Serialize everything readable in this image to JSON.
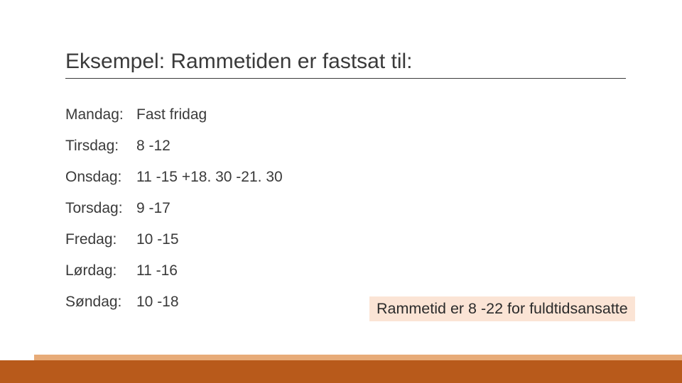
{
  "title": "Eksempel: Rammetiden er fastsat til:",
  "schedule": [
    {
      "day": "Mandag:",
      "value": "Fast fridag"
    },
    {
      "day": "Tirsdag:",
      "value": "8 -12"
    },
    {
      "day": "Onsdag:",
      "value": "11 -15 +18. 30 -21. 30"
    },
    {
      "day": "Torsdag:",
      "value": "9 -17"
    },
    {
      "day": "Fredag:",
      "value": "10 -15"
    },
    {
      "day": "Lørdag:",
      "value": "11 -16"
    },
    {
      "day": "Søndag:",
      "value": "10 -18"
    }
  ],
  "note": "Rammetid er 8 -22 for fuldtidsansatte"
}
